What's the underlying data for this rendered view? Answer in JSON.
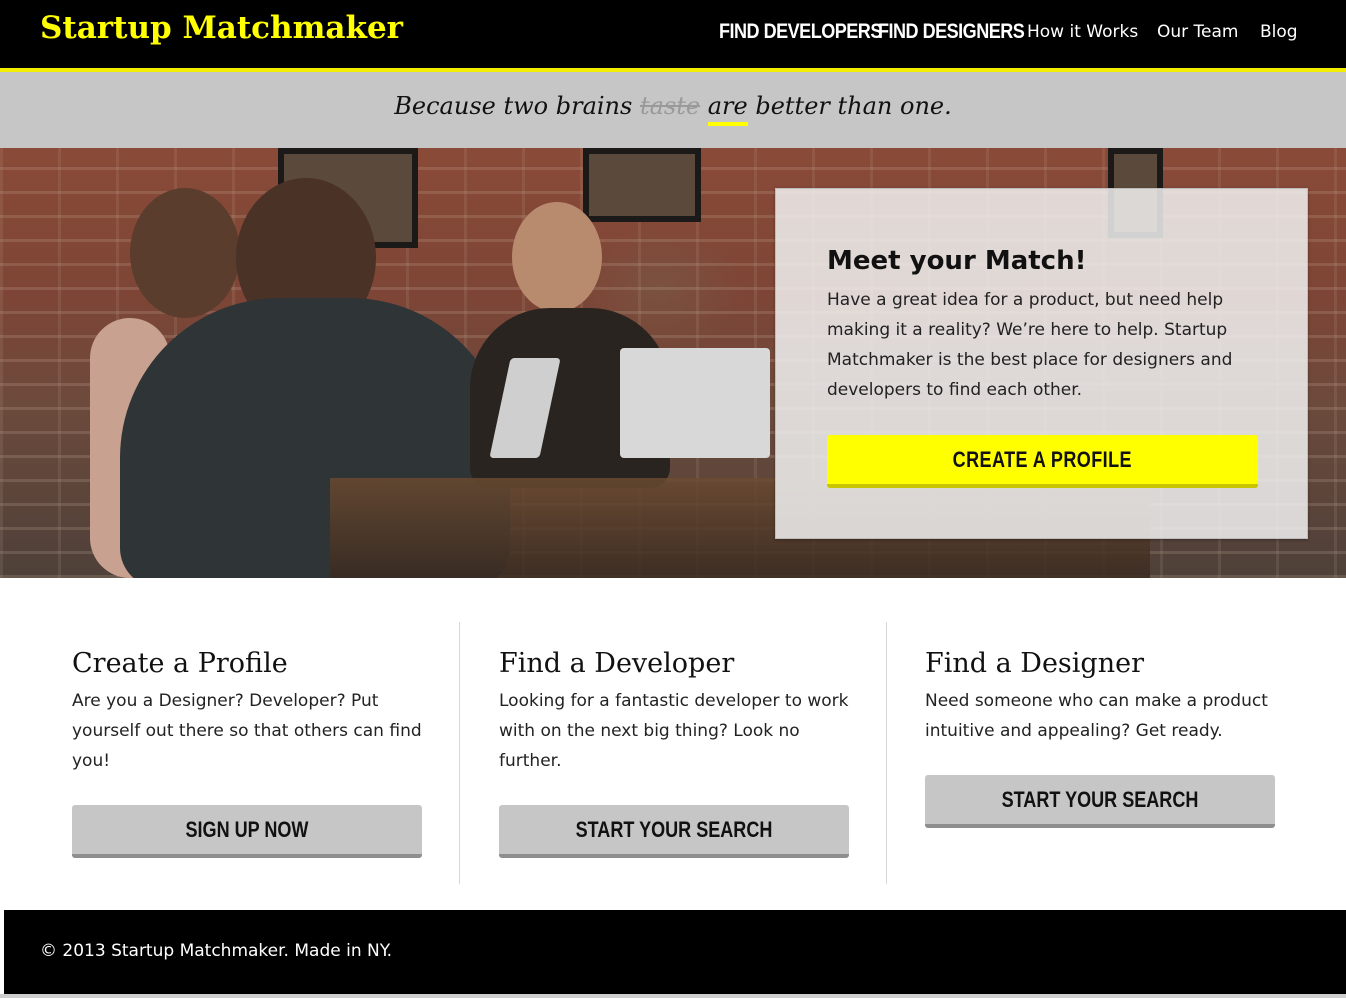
{
  "header": {
    "logo": "Startup Matchmaker",
    "nav": {
      "find_developers": "FIND DEVELOPERS",
      "find_designers": "FIND DESIGNERS",
      "how_it_works": "How it Works",
      "our_team": "Our Team",
      "blog": "Blog"
    }
  },
  "tagline": {
    "before": "Because two brains ",
    "struck": "taste",
    "space": " ",
    "underlined": "are",
    "after": " better than one."
  },
  "hero": {
    "title": "Meet your Match!",
    "text": "Have a great idea for a product, but need help making it a reality? We’re here to help. Startup Matchmaker is the best place for designers and developers to find each other.",
    "button": "CREATE A PROFILE"
  },
  "columns": [
    {
      "title": "Create a Profile",
      "text": "Are you a Designer? Developer? Put yourself out there so that others can find you!",
      "button": "SIGN UP NOW"
    },
    {
      "title": "Find a Developer",
      "text": "Looking for a fantastic developer to work with on the next big thing? Look no further.",
      "button": "START YOUR SEARCH"
    },
    {
      "title": "Find a Designer",
      "text": "Need someone who can make a product intuitive and appealing? Get ready.",
      "button": "START YOUR SEARCH"
    }
  ],
  "footer": {
    "text": "© 2013 Startup Matchmaker. Made in NY."
  },
  "colors": {
    "brand_yellow": "#ffff00",
    "header_bg": "#000000",
    "tagline_bg": "#c6c6c6",
    "secondary_button": "#c6c6c6"
  }
}
